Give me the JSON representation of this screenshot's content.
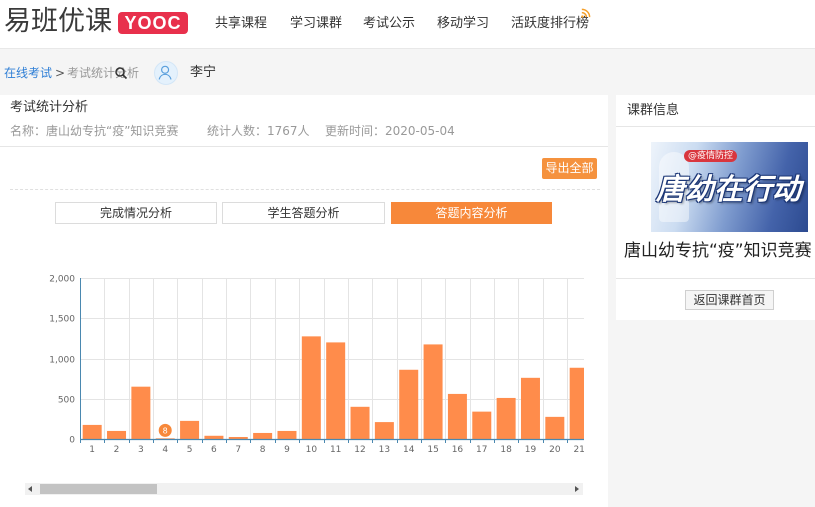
{
  "header": {
    "logo_text": "易班优课",
    "logo_badge": "YOOC",
    "nav": [
      {
        "label": "共享课程"
      },
      {
        "label": "学习课群"
      },
      {
        "label": "考试公示"
      },
      {
        "label": "移动学习"
      },
      {
        "label": "活跃度排行榜"
      }
    ]
  },
  "breadcrumb": {
    "root": "在线考试",
    "separator": ">",
    "current": "考试统计分析"
  },
  "user": {
    "name": "李宁"
  },
  "main": {
    "title": "考试统计分析",
    "info": {
      "name": "名称：唐山幼专抗“疫”知识竞赛",
      "count": "统计人数：1767人",
      "updated": "更新时间：2020-05-04"
    },
    "export_label": "导出全部",
    "tabs": [
      {
        "label": "完成情况分析",
        "active": false
      },
      {
        "label": "学生答题分析",
        "active": false
      },
      {
        "label": "答题内容分析",
        "active": true
      }
    ]
  },
  "sidebar": {
    "title": "课群信息",
    "banner": {
      "tag": "@疫情防控",
      "slogan": "唐幼在行动"
    },
    "course_name": "唐山幼专抗“疫”知识竞赛",
    "back_label": "返回课群首页"
  },
  "icons": {
    "activity_ranking": "signal-icon",
    "breadcrumb_overlay": "search-icon",
    "user": "user-avatar-icon",
    "scroll_left": "arrow-left-icon",
    "scroll_right": "arrow-right-icon"
  },
  "colors": {
    "brand_badge": "#e8304c",
    "link": "#2f7fd6",
    "accent": "#f7883a",
    "bar": "#ff8c4b",
    "marker": "#f7883a",
    "axis": "#4a88b0",
    "grid": "#e4e4e4",
    "tick_text": "#666666"
  },
  "chart_data": {
    "type": "bar",
    "categories": [
      "1",
      "2",
      "3",
      "4",
      "5",
      "6",
      "7",
      "8",
      "9",
      "10",
      "11",
      "12",
      "13",
      "14",
      "15",
      "16",
      "17",
      "18",
      "19",
      "20",
      "21"
    ],
    "values": [
      175,
      100,
      650,
      8,
      225,
      40,
      25,
      75,
      100,
      1275,
      1200,
      400,
      210,
      860,
      1175,
      560,
      340,
      510,
      760,
      275,
      885
    ],
    "ylim": [
      0,
      2000
    ],
    "yticks": [
      0,
      500,
      1000,
      1500,
      2000
    ],
    "ytick_labels": [
      "0",
      "500",
      "1,000",
      "1,500",
      "2,000"
    ],
    "grid": true,
    "marker": {
      "category": "4",
      "label": "8"
    }
  }
}
